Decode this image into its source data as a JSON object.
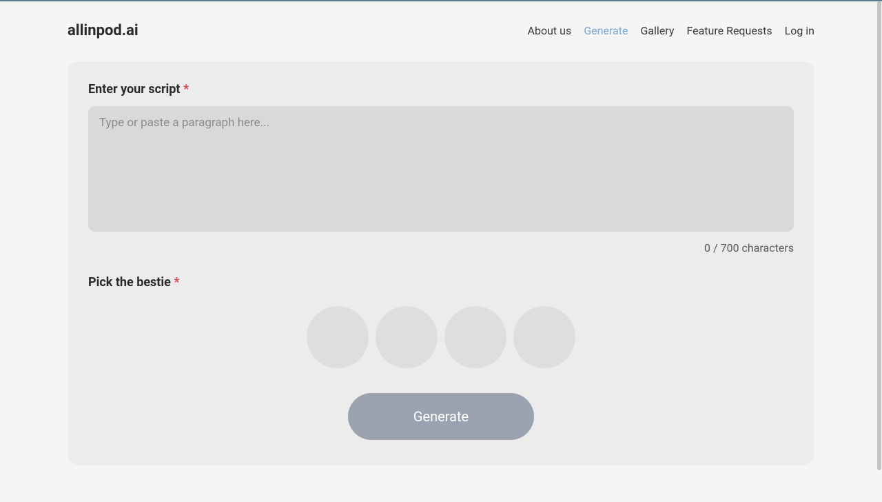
{
  "header": {
    "logo": "allinpod.ai",
    "nav": {
      "about": "About us",
      "generate": "Generate",
      "gallery": "Gallery",
      "feature_requests": "Feature Requests",
      "login": "Log in"
    }
  },
  "form": {
    "script_label": "Enter your script",
    "required_mark": "*",
    "script_placeholder": "Type or paste a paragraph here...",
    "script_value": "",
    "counter": "0 / 700 characters",
    "bestie_label": "Pick the bestie",
    "generate_button": "Generate"
  }
}
